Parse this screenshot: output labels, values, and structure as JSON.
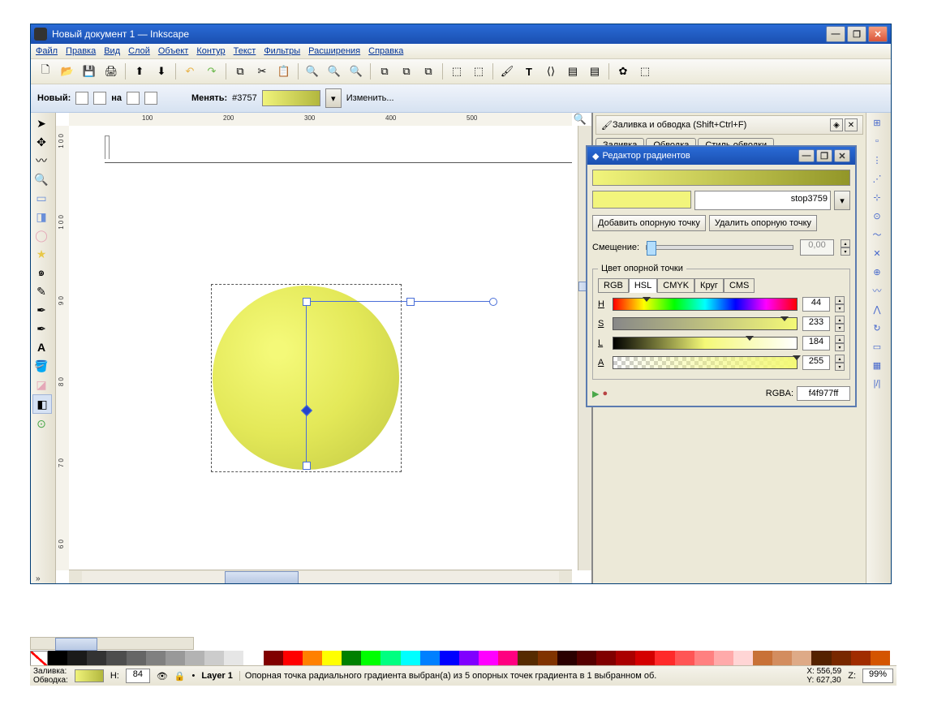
{
  "title": "Новый документ 1 — Inkscape",
  "menu": [
    "Файл",
    "Правка",
    "Вид",
    "Слой",
    "Объект",
    "Контур",
    "Текст",
    "Фильтры",
    "Расширения",
    "Справка"
  ],
  "options": {
    "new": "Новый:",
    "on": "на",
    "change": "Менять:",
    "gradId": "#3757",
    "edit": "Изменить..."
  },
  "ruler_h": [
    "100",
    "200",
    "300",
    "400",
    "500"
  ],
  "ruler_v": [
    "1 0 0",
    "1 0 0",
    "9 0",
    "8 0",
    "7 0",
    "6 0"
  ],
  "dock": {
    "title": "Заливка и обводка (Shift+Ctrl+F)",
    "tabs": [
      "Заливка",
      "Обводка",
      "Стиль обводки"
    ]
  },
  "ge": {
    "title": "Редактор градиентов",
    "stopName": "stop3759",
    "addStop": "Добавить опорную точку",
    "delStop": "Удалить опорную точку",
    "offset": "Смещение:",
    "offsetVal": "0,00",
    "legend": "Цвет опорной точки",
    "colorTabs": [
      "RGB",
      "HSL",
      "CMYK",
      "Круг",
      "CMS"
    ],
    "hsl": {
      "h": {
        "lbl": "H",
        "val": "44"
      },
      "s": {
        "lbl": "S",
        "val": "233"
      },
      "l": {
        "lbl": "L",
        "val": "184"
      },
      "a": {
        "lbl": "A",
        "val": "255"
      }
    },
    "rgba": {
      "lbl": "RGBA:",
      "val": "f4f977ff"
    }
  },
  "status": {
    "fill": "Заливка:",
    "stroke": "Обводка:",
    "h": "Н:",
    "hval": "84",
    "layer": "Layer 1",
    "msg": "Опорная точка радиального градиента выбран(а) из 5 опорных точек градиента в 1 выбранном об.",
    "x": "X:",
    "xval": "556,59",
    "y": "Y:",
    "yval": "627,30",
    "z": "Z:",
    "zval": "99%"
  }
}
